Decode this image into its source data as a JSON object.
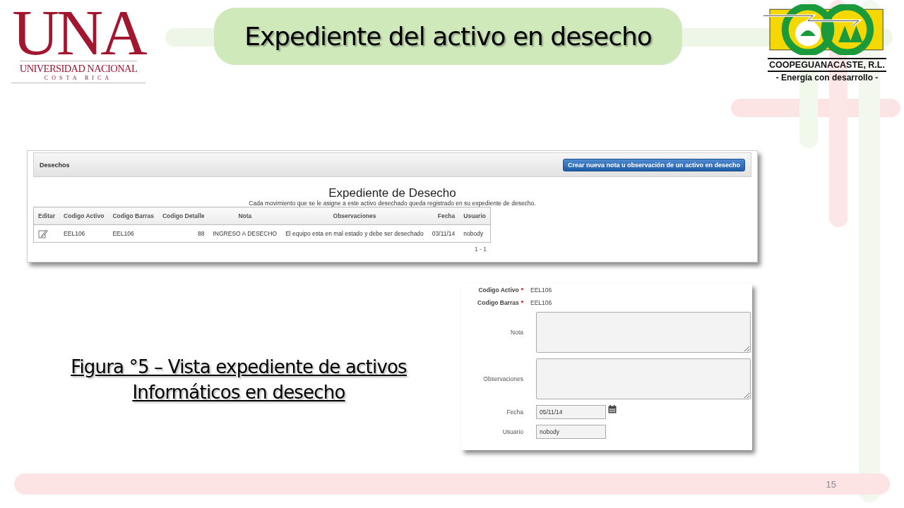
{
  "slide": {
    "title": "Expediente del activo en desecho",
    "number": "15"
  },
  "logos": {
    "left": {
      "name": "UNA",
      "line1": "UNIVERSIDAD NACIONAL",
      "line2": "COSTA RICA"
    },
    "right": {
      "name": "COOPEGUANACASTE, R.L.",
      "tagline": "- Energía con desarrollo -"
    }
  },
  "caption_lines": [
    "Figura °5 – Vista expediente de activos",
    "Informáticos en desecho"
  ],
  "panel": {
    "title": "Desechos",
    "button": "Crear nueva nota u observación de un activo en desecho",
    "heading": "Expediente de Desecho",
    "subtitle": "Cada movimiento que se le asigne a este activo desechado queda registrado en su expediente de desecho.",
    "columns": [
      "Editar",
      "Codigo Activo",
      "Codigo Barras",
      "Codigo Detalle",
      "Nota",
      "Observaciones",
      "Fecha",
      "Usuario"
    ],
    "rows": [
      {
        "editable": true,
        "cells": [
          "",
          "EEL106",
          "EEL106",
          "88",
          "INGRESO A DESECHO",
          "El equipo esta en mal estado y debe ser desechado",
          "03/11/14",
          "nobody"
        ]
      }
    ],
    "pager": "1 - 1"
  },
  "form": {
    "fields": [
      {
        "kind": "text",
        "label": "Codigo Activo",
        "required_mark": "*",
        "value": "EEL106"
      },
      {
        "kind": "text",
        "label": "Codigo Barras",
        "required_mark": "*",
        "value": "EEL106"
      },
      {
        "kind": "textarea",
        "label": "Nota"
      },
      {
        "kind": "textarea",
        "label": "Observaciones"
      },
      {
        "kind": "date",
        "label": "Fecha",
        "value": "05/11/14"
      },
      {
        "kind": "input",
        "label": "Usuario",
        "value": "nobody"
      }
    ]
  }
}
